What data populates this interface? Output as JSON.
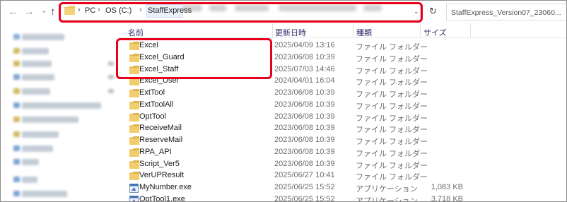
{
  "nav": {
    "back": "←",
    "forward": "→",
    "history": "⌄",
    "up": "↑",
    "refresh": "↻"
  },
  "breadcrumb": {
    "items": [
      "PC",
      "OS (C:)",
      "StaffExpress"
    ],
    "separator": "›"
  },
  "search": {
    "text": "StaffExpress_Version07_23060..."
  },
  "columns": {
    "name": "名前",
    "date": "更新日時",
    "type": "種類",
    "size": "サイズ"
  },
  "files": [
    {
      "name": "Excel",
      "date": "2025/04/09 13:16",
      "type": "ファイル フォルダー",
      "size": "",
      "icon": "folder-icon"
    },
    {
      "name": "Excel_Guard",
      "date": "2023/06/08 10:39",
      "type": "ファイル フォルダー",
      "size": "",
      "icon": "folder-icon"
    },
    {
      "name": "Excel_Staff",
      "date": "2025/07/03 14:46",
      "type": "ファイル フォルダー",
      "size": "",
      "icon": "folder-icon"
    },
    {
      "name": "Excel_User",
      "date": "2024/04/01 16:04",
      "type": "ファイル フォルダー",
      "size": "",
      "icon": "folder-icon"
    },
    {
      "name": "ExtTool",
      "date": "2023/06/08 10:39",
      "type": "ファイル フォルダー",
      "size": "",
      "icon": "folder-icon"
    },
    {
      "name": "ExtToolAll",
      "date": "2023/06/08 10:39",
      "type": "ファイル フォルダー",
      "size": "",
      "icon": "folder-icon"
    },
    {
      "name": "OptTool",
      "date": "2023/06/08 10:39",
      "type": "ファイル フォルダー",
      "size": "",
      "icon": "folder-icon"
    },
    {
      "name": "ReceiveMail",
      "date": "2023/06/08 10:39",
      "type": "ファイル フォルダー",
      "size": "",
      "icon": "folder-icon"
    },
    {
      "name": "ReserveMail",
      "date": "2023/06/08 10:39",
      "type": "ファイル フォルダー",
      "size": "",
      "icon": "folder-icon"
    },
    {
      "name": "RPA_API",
      "date": "2023/06/08 10:39",
      "type": "ファイル フォルダー",
      "size": "",
      "icon": "folder-icon"
    },
    {
      "name": "Script_Ver5",
      "date": "2023/06/08 10:39",
      "type": "ファイル フォルダー",
      "size": "",
      "icon": "folder-icon"
    },
    {
      "name": "VerUPResult",
      "date": "2025/06/27 10:41",
      "type": "ファイル フォルダー",
      "size": "",
      "icon": "folder-icon"
    },
    {
      "name": "MyNumber.exe",
      "date": "2025/06/25 15:52",
      "type": "アプリケーション",
      "size": "1,083 KB",
      "icon": "application-icon"
    },
    {
      "name": "OptTool1.exe",
      "date": "2025/06/25 15:52",
      "type": "アプリケーション",
      "size": "3,718 KB",
      "icon": "application-icon"
    }
  ],
  "colors": {
    "folder": "#e8c25a",
    "annotation": "#e8001c",
    "header_text": "#2f2f6e"
  }
}
